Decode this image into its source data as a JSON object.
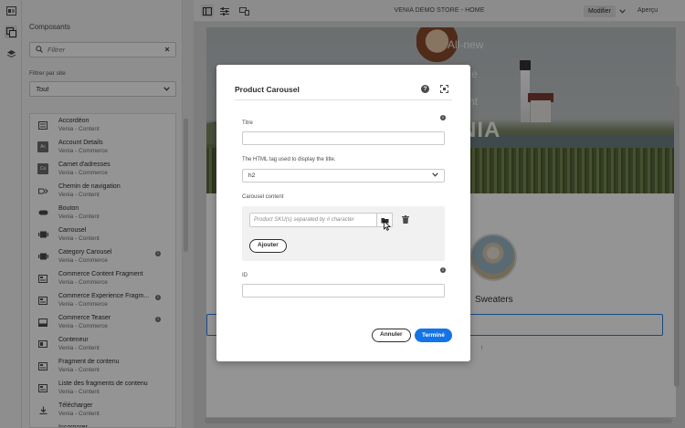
{
  "topbar": {
    "page_title": "VENIA DEMO STORE - HOME",
    "mode_label": "Modifier",
    "preview_label": "Aperçu"
  },
  "panel": {
    "title": "Composants",
    "search_placeholder": "Filtrer",
    "filter_label": "Filtrer par site",
    "filter_value": "Tout",
    "items": [
      {
        "name": "Accordéon",
        "group": "Venia - Content",
        "icon": "accordion-icon"
      },
      {
        "name": "Account Details",
        "group": "Venia - Commerce",
        "icon": "abbr-icon",
        "abbr": "Ac"
      },
      {
        "name": "Carnet d'adresses",
        "group": "Venia - Commerce",
        "icon": "abbr-icon",
        "abbr": "Ca"
      },
      {
        "name": "Chemin de navigation",
        "group": "Venia - Content",
        "icon": "breadcrumb-icon"
      },
      {
        "name": "Bouton",
        "group": "Venia - Content",
        "icon": "button-icon"
      },
      {
        "name": "Carrousel",
        "group": "Venia - Content",
        "icon": "carousel-icon"
      },
      {
        "name": "Category Carousel",
        "group": "Venia - Commerce",
        "icon": "carousel-icon",
        "info": true
      },
      {
        "name": "Commerce Content Fragment",
        "group": "Venia - Commerce",
        "icon": "fragment-icon"
      },
      {
        "name": "Commerce Experience Fragm...",
        "group": "Venia - Commerce",
        "icon": "fragment-icon",
        "info": true
      },
      {
        "name": "Commerce Teaser",
        "group": "Venia - Commerce",
        "icon": "teaser-icon",
        "info": true
      },
      {
        "name": "Conteneur",
        "group": "Venia - Content",
        "icon": "container-icon"
      },
      {
        "name": "Fragment de contenu",
        "group": "Venia - Content",
        "icon": "fragment-icon"
      },
      {
        "name": "Liste des fragments de contenu",
        "group": "Venia - Content",
        "icon": "fragment-icon"
      },
      {
        "name": "Télécharger",
        "group": "Venia - Content",
        "icon": "download-icon"
      },
      {
        "name": "Incorporer",
        "group": "Venia - Content",
        "icon": "embed-icon"
      }
    ]
  },
  "page": {
    "hero_line1": "All-new",
    "hero_line2": "e",
    "hero_line3": "nt",
    "hero_big": "NIA",
    "section_label": "Sweaters",
    "small_c": "l"
  },
  "dialog": {
    "title": "Product Carousel",
    "title_label": "Titre",
    "title_value": "",
    "tag_label": "The HTML tag used to display the title.",
    "tag_value": "h2",
    "carousel_label": "Carousel content",
    "sku_placeholder": "Product SKU(s) separated by # character",
    "add_label": "Ajouter",
    "id_label": "ID",
    "id_value": "",
    "cancel_label": "Annuler",
    "done_label": "Terminé"
  },
  "colors": {
    "accent": "#1473e6",
    "selection_outline": "#2680eb",
    "overlay": "rgba(0,0,0,0.42)"
  }
}
